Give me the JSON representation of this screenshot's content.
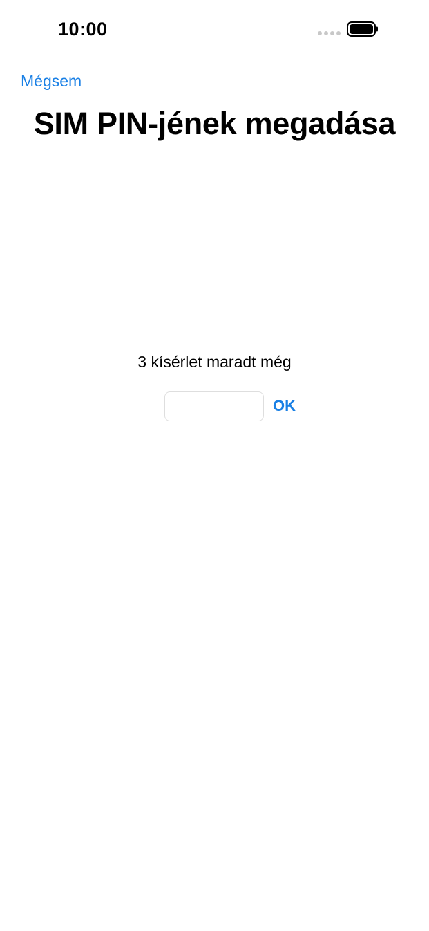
{
  "status_bar": {
    "time": "10:00",
    "signal_icon": "cellular-signal-dots-icon",
    "battery_icon": "battery-full-icon"
  },
  "nav": {
    "cancel_label": "Mégsem"
  },
  "header": {
    "title": "SIM PIN-jének megadása"
  },
  "pin_entry": {
    "attempts_text": "3 kísérlet maradt még",
    "input_value": "",
    "input_placeholder": "",
    "ok_label": "OK"
  },
  "colors": {
    "accent": "#1a80e5",
    "text": "#000000",
    "background": "#ffffff",
    "input_border": "#dedede"
  }
}
